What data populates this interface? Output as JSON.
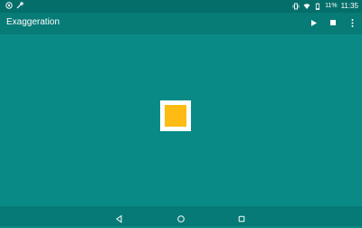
{
  "status_bar": {
    "battery_percent": "11%",
    "time": "11:35",
    "icons": [
      "notification-icon",
      "link-icon",
      "vibrate-icon",
      "wifi-icon",
      "battery-icon"
    ]
  },
  "app_bar": {
    "title": "Exaggeration",
    "actions": [
      "play-icon",
      "stop-icon",
      "overflow-menu-icon"
    ]
  },
  "content": {
    "square_outer_color": "#ffffff",
    "square_inner_color": "#fdbb13"
  },
  "nav_bar": {
    "buttons": [
      "back-icon",
      "home-icon",
      "recents-icon"
    ]
  },
  "colors": {
    "background": "#0a8a86",
    "app_bar": "#077b76",
    "status_bar": "#046e6a",
    "accent": "#fdbb13"
  }
}
